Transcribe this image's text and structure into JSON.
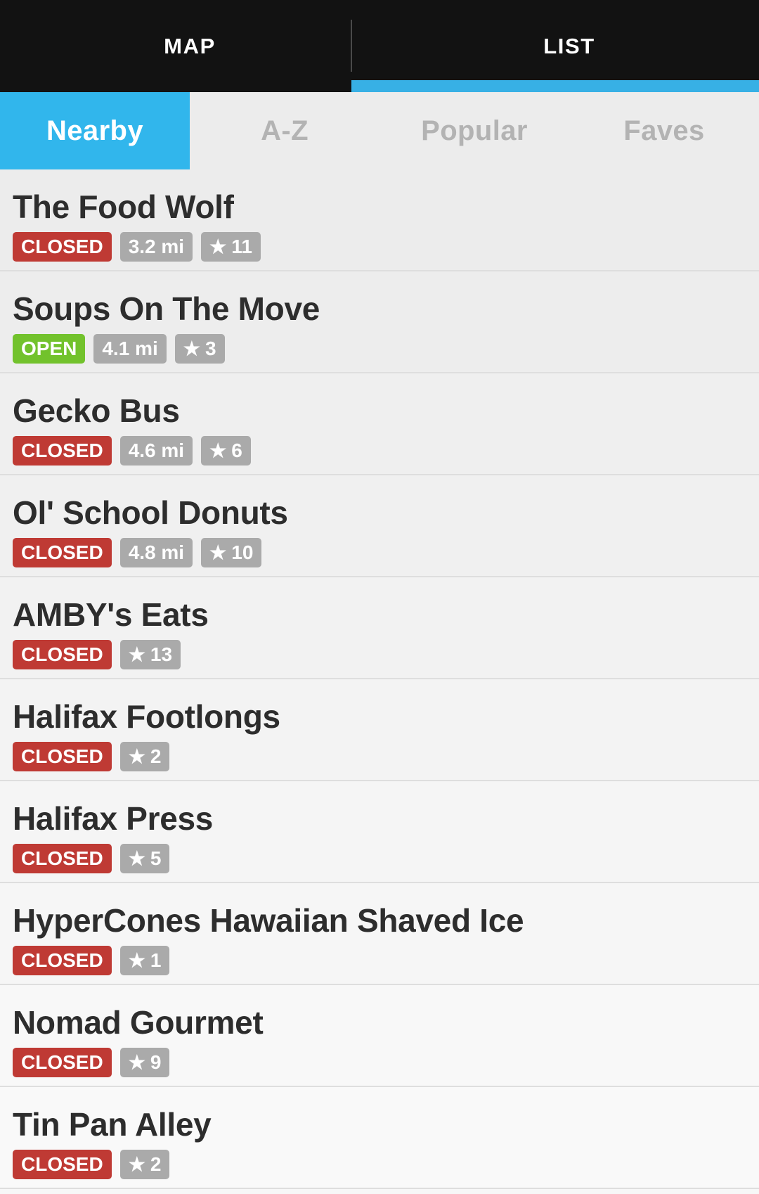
{
  "topbar": {
    "tabs": [
      {
        "label": "MAP",
        "active": false
      },
      {
        "label": "LIST",
        "active": true
      }
    ],
    "indicator_color": "#37b0e5"
  },
  "sortbar": {
    "active_color": "#31b6ec",
    "inactive_text_color": "#b3b3b3",
    "tabs": [
      {
        "label": "Nearby",
        "active": true
      },
      {
        "label": "A-Z",
        "active": false
      },
      {
        "label": "Popular",
        "active": false
      },
      {
        "label": "Faves",
        "active": false
      }
    ]
  },
  "badge_colors": {
    "closed": "#bf3a34",
    "open": "#72c22c",
    "neutral": "#aaaaaa"
  },
  "icons": {
    "star": "★"
  },
  "list": {
    "items": [
      {
        "name": "The Food Wolf",
        "status": "CLOSED",
        "status_kind": "closed",
        "distance": "3.2 mi",
        "rating": "11"
      },
      {
        "name": "Soups On The Move",
        "status": "OPEN",
        "status_kind": "open",
        "distance": "4.1 mi",
        "rating": "3"
      },
      {
        "name": "Gecko Bus",
        "status": "CLOSED",
        "status_kind": "closed",
        "distance": "4.6 mi",
        "rating": "6"
      },
      {
        "name": "Ol' School Donuts",
        "status": "CLOSED",
        "status_kind": "closed",
        "distance": "4.8 mi",
        "rating": "10"
      },
      {
        "name": "AMBY's Eats",
        "status": "CLOSED",
        "status_kind": "closed",
        "distance": null,
        "rating": "13"
      },
      {
        "name": "Halifax Footlongs",
        "status": "CLOSED",
        "status_kind": "closed",
        "distance": null,
        "rating": "2"
      },
      {
        "name": "Halifax Press",
        "status": "CLOSED",
        "status_kind": "closed",
        "distance": null,
        "rating": "5"
      },
      {
        "name": "HyperCones Hawaiian Shaved Ice",
        "status": "CLOSED",
        "status_kind": "closed",
        "distance": null,
        "rating": "1"
      },
      {
        "name": "Nomad Gourmet",
        "status": "CLOSED",
        "status_kind": "closed",
        "distance": null,
        "rating": "9"
      },
      {
        "name": "Tin Pan Alley",
        "status": "CLOSED",
        "status_kind": "closed",
        "distance": null,
        "rating": "2"
      }
    ]
  }
}
